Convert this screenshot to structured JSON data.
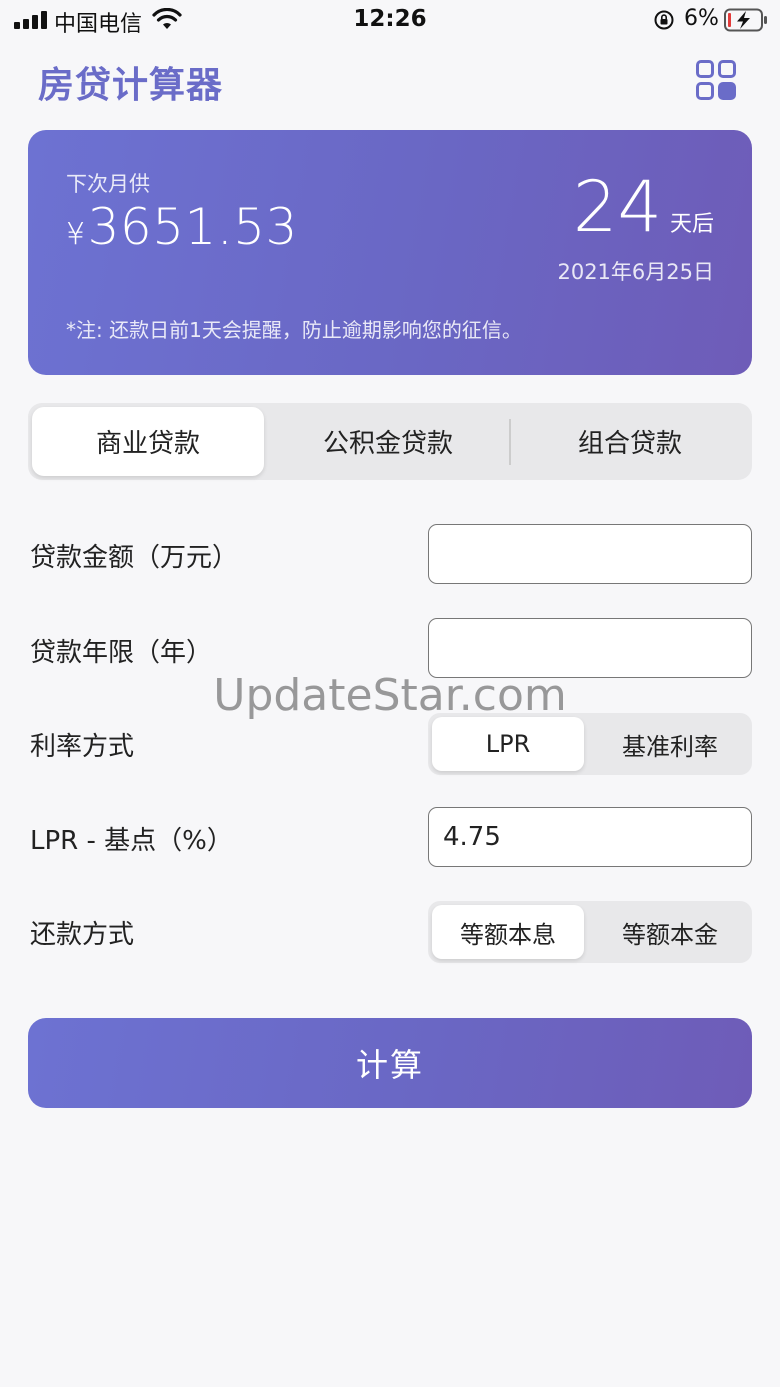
{
  "status_bar": {
    "carrier": "中国电信",
    "time": "12:26",
    "battery_percent": "6%"
  },
  "header": {
    "title": "房贷计算器",
    "menu_icon": "grid-icon"
  },
  "hero": {
    "label": "下次月供",
    "currency": "¥",
    "amount": "3651.53",
    "days": "24",
    "days_unit": "天后",
    "date": "2021年6月25日",
    "note": "*注: 还款日前1天会提醒，防止逾期影响您的征信。"
  },
  "tabs": [
    {
      "label": "商业贷款",
      "active": true
    },
    {
      "label": "公积金贷款",
      "active": false
    },
    {
      "label": "组合贷款",
      "active": false
    }
  ],
  "form": {
    "loan_amount_label": "贷款金额（万元）",
    "loan_amount_value": "",
    "loan_years_label": "贷款年限（年）",
    "loan_years_value": "",
    "rate_mode_label": "利率方式",
    "rate_mode_options": [
      "LPR",
      "基准利率"
    ],
    "rate_mode_selected": "LPR",
    "lpr_label": "LPR - 基点（%）",
    "lpr_value": "4.75",
    "repay_mode_label": "还款方式",
    "repay_mode_options": [
      "等额本息",
      "等额本金"
    ],
    "repay_mode_selected": "等额本息"
  },
  "watermark": "UpdateStar.com",
  "calculate_label": "计算",
  "colors": {
    "accent": "#6a6cc8",
    "gradient_start": "#6d72d2",
    "gradient_end": "#6e5cb8"
  }
}
